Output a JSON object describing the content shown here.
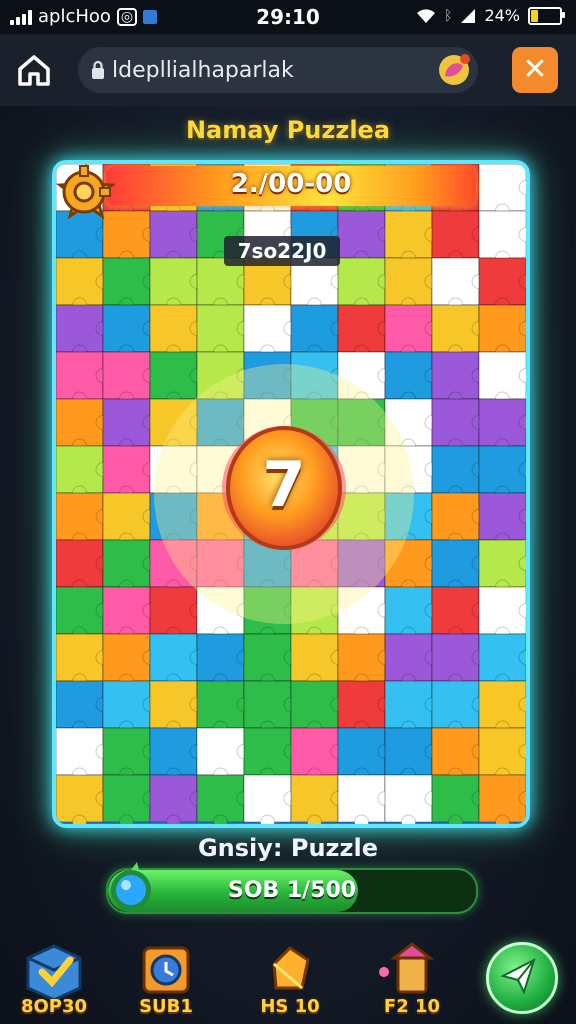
{
  "status_bar": {
    "carrier": "aplcHoo",
    "time": "29:10",
    "battery": "24%",
    "battery_level": 0.24
  },
  "browser": {
    "url": "ldepllialhaparlak",
    "home_icon": "home-icon",
    "lock_icon": "lock-icon",
    "close_icon": "close-icon"
  },
  "game": {
    "title": "Namay Puzzlea",
    "progress_text": "2./00-00",
    "code": "7so22J0",
    "level": "7",
    "status_label": "Gnsiy: Puzzle",
    "energy_text": "SOB 1/500",
    "energy_level": 0.68
  },
  "bottom_bar": {
    "items": [
      {
        "label": "8OP30",
        "icon": "cube-check-icon"
      },
      {
        "label": "SUB1",
        "icon": "clock-box-icon"
      },
      {
        "label": "HS 10",
        "icon": "gem-icon"
      },
      {
        "label": "F2 10",
        "icon": "tower-icon"
      }
    ],
    "play_icon": "paper-plane-icon"
  },
  "colors": {
    "accent_yellow": "#ffd93a",
    "board_glow": "#5ee7ff",
    "energy_green": "#27b53a",
    "close_orange": "#f58a2c"
  }
}
